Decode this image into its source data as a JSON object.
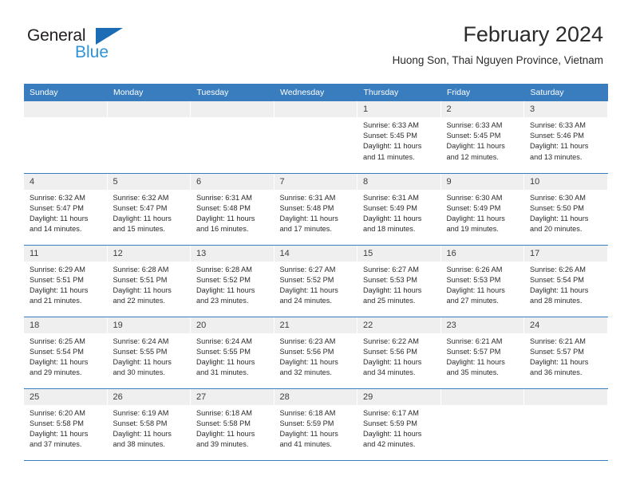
{
  "brand": {
    "name_part1": "General",
    "name_part2": "Blue",
    "flag_icon": "blue-triangle-flag-icon",
    "accent_dark": "#1c6cb5",
    "accent_light": "#2f93d8"
  },
  "header": {
    "title": "February 2024",
    "subtitle": "Huong Son, Thai Nguyen Province, Vietnam"
  },
  "theme": {
    "header_row_bg": "#3a7dbf",
    "daynum_bg": "#efefef",
    "row_divider": "#3a7dbf",
    "text": "#2b2b2b"
  },
  "weekdays": [
    "Sunday",
    "Monday",
    "Tuesday",
    "Wednesday",
    "Thursday",
    "Friday",
    "Saturday"
  ],
  "labels": {
    "sunrise_prefix": "Sunrise:",
    "sunset_prefix": "Sunset:",
    "daylight_prefix": "Daylight:"
  },
  "weeks": [
    [
      {
        "day": "",
        "empty": true
      },
      {
        "day": "",
        "empty": true
      },
      {
        "day": "",
        "empty": true
      },
      {
        "day": "",
        "empty": true
      },
      {
        "day": "1",
        "sunrise": "Sunrise: 6:33 AM",
        "sunset": "Sunset: 5:45 PM",
        "daylight": "Daylight: 11 hours and 11 minutes."
      },
      {
        "day": "2",
        "sunrise": "Sunrise: 6:33 AM",
        "sunset": "Sunset: 5:45 PM",
        "daylight": "Daylight: 11 hours and 12 minutes."
      },
      {
        "day": "3",
        "sunrise": "Sunrise: 6:33 AM",
        "sunset": "Sunset: 5:46 PM",
        "daylight": "Daylight: 11 hours and 13 minutes."
      }
    ],
    [
      {
        "day": "4",
        "sunrise": "Sunrise: 6:32 AM",
        "sunset": "Sunset: 5:47 PM",
        "daylight": "Daylight: 11 hours and 14 minutes."
      },
      {
        "day": "5",
        "sunrise": "Sunrise: 6:32 AM",
        "sunset": "Sunset: 5:47 PM",
        "daylight": "Daylight: 11 hours and 15 minutes."
      },
      {
        "day": "6",
        "sunrise": "Sunrise: 6:31 AM",
        "sunset": "Sunset: 5:48 PM",
        "daylight": "Daylight: 11 hours and 16 minutes."
      },
      {
        "day": "7",
        "sunrise": "Sunrise: 6:31 AM",
        "sunset": "Sunset: 5:48 PM",
        "daylight": "Daylight: 11 hours and 17 minutes."
      },
      {
        "day": "8",
        "sunrise": "Sunrise: 6:31 AM",
        "sunset": "Sunset: 5:49 PM",
        "daylight": "Daylight: 11 hours and 18 minutes."
      },
      {
        "day": "9",
        "sunrise": "Sunrise: 6:30 AM",
        "sunset": "Sunset: 5:49 PM",
        "daylight": "Daylight: 11 hours and 19 minutes."
      },
      {
        "day": "10",
        "sunrise": "Sunrise: 6:30 AM",
        "sunset": "Sunset: 5:50 PM",
        "daylight": "Daylight: 11 hours and 20 minutes."
      }
    ],
    [
      {
        "day": "11",
        "sunrise": "Sunrise: 6:29 AM",
        "sunset": "Sunset: 5:51 PM",
        "daylight": "Daylight: 11 hours and 21 minutes."
      },
      {
        "day": "12",
        "sunrise": "Sunrise: 6:28 AM",
        "sunset": "Sunset: 5:51 PM",
        "daylight": "Daylight: 11 hours and 22 minutes."
      },
      {
        "day": "13",
        "sunrise": "Sunrise: 6:28 AM",
        "sunset": "Sunset: 5:52 PM",
        "daylight": "Daylight: 11 hours and 23 minutes."
      },
      {
        "day": "14",
        "sunrise": "Sunrise: 6:27 AM",
        "sunset": "Sunset: 5:52 PM",
        "daylight": "Daylight: 11 hours and 24 minutes."
      },
      {
        "day": "15",
        "sunrise": "Sunrise: 6:27 AM",
        "sunset": "Sunset: 5:53 PM",
        "daylight": "Daylight: 11 hours and 25 minutes."
      },
      {
        "day": "16",
        "sunrise": "Sunrise: 6:26 AM",
        "sunset": "Sunset: 5:53 PM",
        "daylight": "Daylight: 11 hours and 27 minutes."
      },
      {
        "day": "17",
        "sunrise": "Sunrise: 6:26 AM",
        "sunset": "Sunset: 5:54 PM",
        "daylight": "Daylight: 11 hours and 28 minutes."
      }
    ],
    [
      {
        "day": "18",
        "sunrise": "Sunrise: 6:25 AM",
        "sunset": "Sunset: 5:54 PM",
        "daylight": "Daylight: 11 hours and 29 minutes."
      },
      {
        "day": "19",
        "sunrise": "Sunrise: 6:24 AM",
        "sunset": "Sunset: 5:55 PM",
        "daylight": "Daylight: 11 hours and 30 minutes."
      },
      {
        "day": "20",
        "sunrise": "Sunrise: 6:24 AM",
        "sunset": "Sunset: 5:55 PM",
        "daylight": "Daylight: 11 hours and 31 minutes."
      },
      {
        "day": "21",
        "sunrise": "Sunrise: 6:23 AM",
        "sunset": "Sunset: 5:56 PM",
        "daylight": "Daylight: 11 hours and 32 minutes."
      },
      {
        "day": "22",
        "sunrise": "Sunrise: 6:22 AM",
        "sunset": "Sunset: 5:56 PM",
        "daylight": "Daylight: 11 hours and 34 minutes."
      },
      {
        "day": "23",
        "sunrise": "Sunrise: 6:21 AM",
        "sunset": "Sunset: 5:57 PM",
        "daylight": "Daylight: 11 hours and 35 minutes."
      },
      {
        "day": "24",
        "sunrise": "Sunrise: 6:21 AM",
        "sunset": "Sunset: 5:57 PM",
        "daylight": "Daylight: 11 hours and 36 minutes."
      }
    ],
    [
      {
        "day": "25",
        "sunrise": "Sunrise: 6:20 AM",
        "sunset": "Sunset: 5:58 PM",
        "daylight": "Daylight: 11 hours and 37 minutes."
      },
      {
        "day": "26",
        "sunrise": "Sunrise: 6:19 AM",
        "sunset": "Sunset: 5:58 PM",
        "daylight": "Daylight: 11 hours and 38 minutes."
      },
      {
        "day": "27",
        "sunrise": "Sunrise: 6:18 AM",
        "sunset": "Sunset: 5:58 PM",
        "daylight": "Daylight: 11 hours and 39 minutes."
      },
      {
        "day": "28",
        "sunrise": "Sunrise: 6:18 AM",
        "sunset": "Sunset: 5:59 PM",
        "daylight": "Daylight: 11 hours and 41 minutes."
      },
      {
        "day": "29",
        "sunrise": "Sunrise: 6:17 AM",
        "sunset": "Sunset: 5:59 PM",
        "daylight": "Daylight: 11 hours and 42 minutes."
      },
      {
        "day": "",
        "empty": true
      },
      {
        "day": "",
        "empty": true
      }
    ]
  ]
}
